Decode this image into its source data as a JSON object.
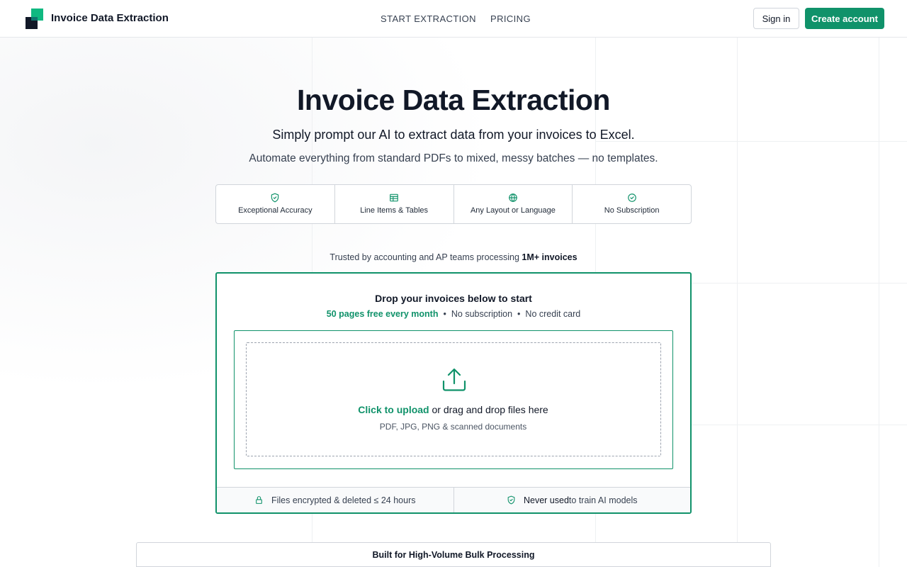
{
  "header": {
    "brand": "Invoice Data Extraction",
    "nav": [
      "START EXTRACTION",
      "PRICING"
    ],
    "sign_in": "Sign in",
    "create_account": "Create account"
  },
  "hero": {
    "title": "Invoice Data Extraction",
    "subtitle": "Simply prompt our AI to extract data from your invoices to Excel.",
    "subtitle2": "Automate everything from standard PDFs to mixed, messy batches — no templates."
  },
  "features": [
    {
      "icon": "shield-check-icon",
      "label": "Exceptional Accuracy"
    },
    {
      "icon": "table-icon",
      "label": "Line Items & Tables"
    },
    {
      "icon": "globe-icon",
      "label": "Any Layout or Language"
    },
    {
      "icon": "check-circle-icon",
      "label": "No Subscription"
    }
  ],
  "trusted": {
    "prefix": "Trusted by accounting and AP teams processing ",
    "highlight": "1M+ invoices"
  },
  "upload": {
    "title": "Drop your invoices below to start",
    "free_pages": "50 pages free every month",
    "bullet": "•",
    "no_subscription": "No subscription",
    "no_credit_card": "No credit card",
    "click_to_upload": "Click to upload",
    "drag_text": " or drag and drop files here",
    "formats": "PDF, JPG, PNG & scanned documents",
    "footer_left": "Files encrypted & deleted ≤ 24 hours",
    "footer_right_strong": "Never used",
    "footer_right_rest": " to train AI models"
  },
  "bulk": {
    "title": "Built for High-Volume Bulk Processing"
  },
  "colors": {
    "accent": "#10926a",
    "text": "#111827",
    "border": "#d1d5db"
  }
}
